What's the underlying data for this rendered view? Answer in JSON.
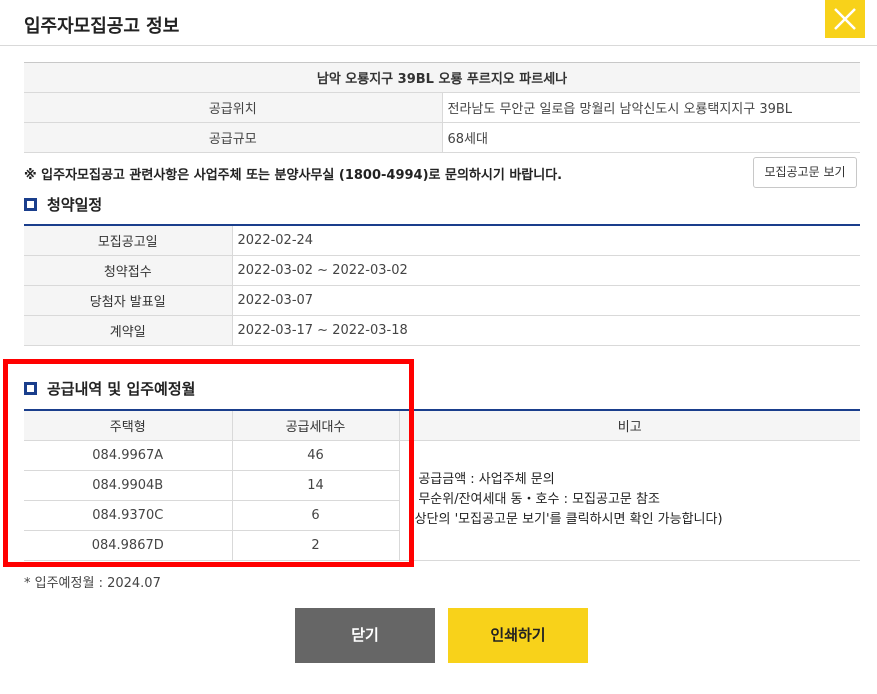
{
  "header": {
    "title": "입주자모집공고 정보",
    "close_icon": "close-icon"
  },
  "info": {
    "complex_name": "남악 오룡지구 39BL 오룡 푸르지오 파르세나",
    "rows": [
      {
        "label": "공급위치",
        "value": "전라남도 무안군 일로읍 망월리 남악신도시 오룡택지지구 39BL"
      },
      {
        "label": "공급규모",
        "value": "68세대"
      }
    ]
  },
  "notice": "※ 입주자모집공고 관련사항은 사업주체 또는 분양사무실 (1800-4994)로 문의하시기 바랍니다.",
  "doc_button": "모집공고문 보기",
  "schedule": {
    "title": "청약일정",
    "rows": [
      {
        "label": "모집공고일",
        "value": "2022-02-24"
      },
      {
        "label": "청약접수",
        "value": "2022-03-02 ~ 2022-03-02"
      },
      {
        "label": "당첨자 발표일",
        "value": "2022-03-07"
      },
      {
        "label": "계약일",
        "value": "2022-03-17 ~ 2022-03-18"
      }
    ]
  },
  "supply": {
    "title": "공급내역 및 입주예정월",
    "headers": [
      "주택형",
      "공급세대수",
      "비고"
    ],
    "rows": [
      {
        "type": "084.9967A",
        "count": "46"
      },
      {
        "type": "084.9904B",
        "count": "14"
      },
      {
        "type": "084.9370C",
        "count": "6"
      },
      {
        "type": "084.9867D",
        "count": "2"
      }
    ],
    "notes": [
      "- 공급금액 : 사업주체 문의",
      "- 무순위/잔여세대 동・호수 : 모집공고문 참조",
      "(상단의 '모집공고문 보기'를 클릭하시면 확인 가능합니다)"
    ]
  },
  "footnote": "* 입주예정월 : 2024.07",
  "buttons": {
    "close": "닫기",
    "print": "인쇄하기"
  },
  "colors": {
    "accent": "#f8d21a",
    "section_blue": "#1a3e8c",
    "highlight_red": "#ff0000",
    "close_button_gray": "#666666"
  }
}
